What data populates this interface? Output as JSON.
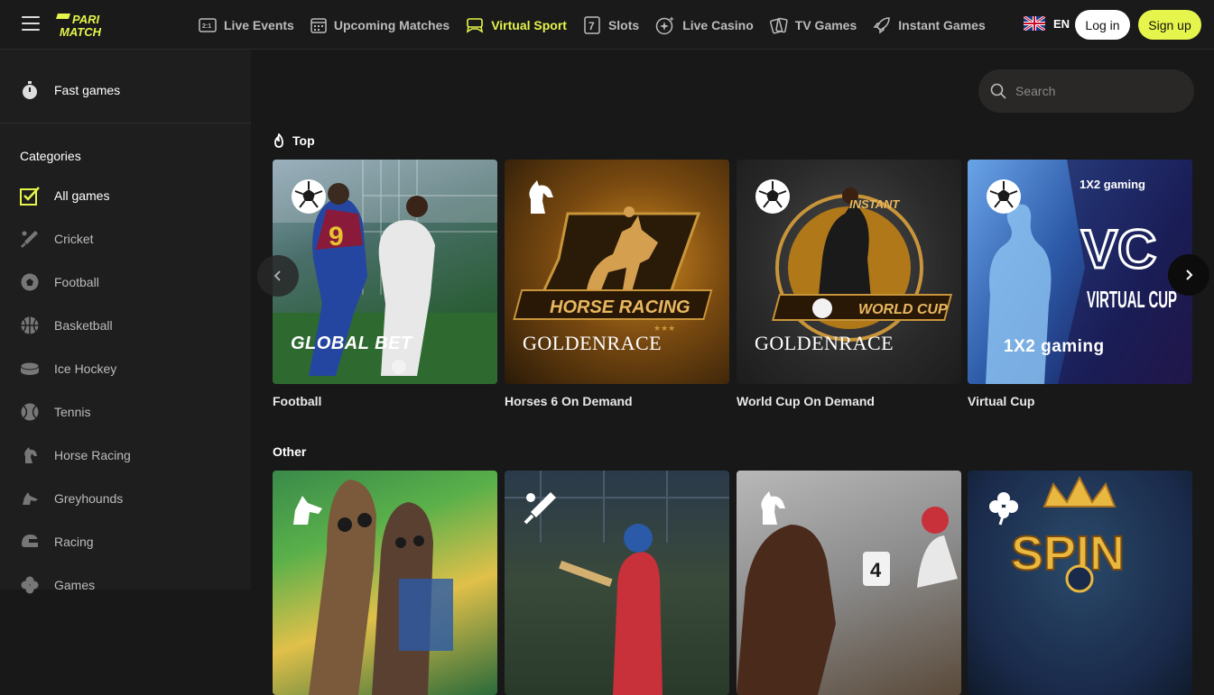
{
  "header": {
    "logo_line1": "PARI",
    "logo_line2": "MATCH",
    "nav": [
      {
        "label": "Live Events",
        "icon": "scoreboard-icon"
      },
      {
        "label": "Upcoming Matches",
        "icon": "calendar-icon"
      },
      {
        "label": "Virtual Sport",
        "icon": "gamepad-icon"
      },
      {
        "label": "Slots",
        "icon": "slot-seven-icon"
      },
      {
        "label": "Live Casino",
        "icon": "sparkle-chip-icon"
      },
      {
        "label": "TV Games",
        "icon": "cards-icon"
      },
      {
        "label": "Instant Games",
        "icon": "rocket-icon"
      }
    ],
    "active_nav": "Virtual Sport",
    "language": "EN",
    "login_label": "Log in",
    "signup_label": "Sign up",
    "accent_color": "#e6f54b"
  },
  "sidebar": {
    "fast_games_label": "Fast games",
    "categories_title": "Categories",
    "items": [
      {
        "label": "All games",
        "icon": "checkbox-icon"
      },
      {
        "label": "Cricket",
        "icon": "cricket-icon"
      },
      {
        "label": "Football",
        "icon": "football-icon"
      },
      {
        "label": "Basketball",
        "icon": "basketball-icon"
      },
      {
        "label": "Ice Hockey",
        "icon": "hockey-puck-icon"
      },
      {
        "label": "Tennis",
        "icon": "tennis-ball-icon"
      },
      {
        "label": "Horse Racing",
        "icon": "horse-icon"
      },
      {
        "label": "Greyhounds",
        "icon": "greyhound-icon"
      },
      {
        "label": "Racing",
        "icon": "helmet-icon"
      },
      {
        "label": "Games",
        "icon": "clover-icon"
      }
    ],
    "active_item": "All games"
  },
  "main": {
    "search_placeholder": "Search",
    "top_title": "Top",
    "other_title": "Other",
    "top_cards": [
      {
        "label": "Football",
        "brand": "GLOBAL BET",
        "icon": "football-icon"
      },
      {
        "label": "Horses 6 On Demand",
        "brand": "GOLDENRACE",
        "icon": "horse-icon"
      },
      {
        "label": "World Cup On Demand",
        "brand": "GOLDENRACE",
        "icon": "football-icon"
      },
      {
        "label": "Virtual Cup",
        "brand": "1X2 gaming",
        "icon": "football-icon"
      }
    ],
    "card_texts": {
      "horse_racing": "HORSE RACING",
      "instant": "INSTANT",
      "world_cup": "WORLD CUP",
      "vc": "VC",
      "virtual_cup": "VIRTUAL CUP",
      "gaming_top": "1X2 gaming",
      "spin": "SPIN",
      "trotter_number": "4"
    },
    "other_cards": [
      {
        "icon": "greyhound-icon"
      },
      {
        "icon": "cricket-icon"
      },
      {
        "icon": "horse-icon"
      },
      {
        "icon": "clover-icon"
      }
    ]
  }
}
